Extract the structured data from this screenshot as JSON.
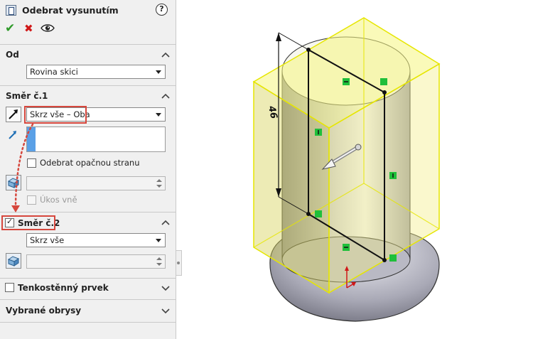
{
  "title": "Odebrat vysunutím",
  "help_symbol": "?",
  "ok_symbol": "✔",
  "cancel_symbol": "✖",
  "from": {
    "title": "Od",
    "selected": "Rovina skici"
  },
  "direction1": {
    "title": "Směr č.1",
    "selected": "Skrz vše – Oba",
    "flip_side_label": "Odebrat opačnou stranu",
    "flip_side_checked": false,
    "draft_outward_label": "Úkos vně",
    "draft_outward_checked": false
  },
  "direction2": {
    "title": "Směr č.2",
    "checked": true,
    "selected": "Skrz vše"
  },
  "thin_feature": {
    "title": "Tenkostěnný prvek",
    "checked": false
  },
  "selected_contours": {
    "title": "Vybrané obrysy"
  },
  "dimension_label": "46",
  "colors": {
    "accent_red": "#d6473d",
    "ok_green": "#2f9a2a",
    "cancel_red": "#d01818",
    "preview_yellow": "#f2f27a",
    "preview_edge": "#e6e600",
    "constraint_green": "#1fbf3a"
  }
}
